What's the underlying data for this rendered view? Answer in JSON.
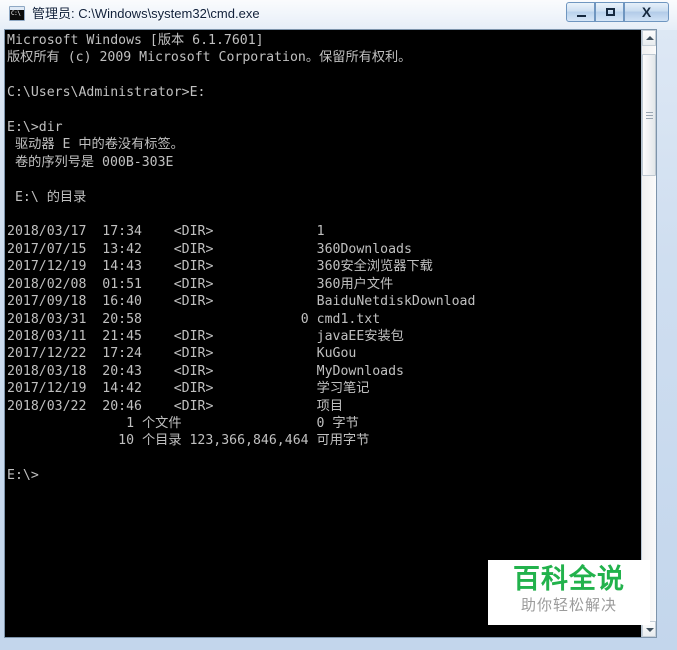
{
  "window": {
    "title": "管理员: C:\\Windows\\system32\\cmd.exe",
    "icon": "cmd-console-icon",
    "icon_prompt": "C:\\",
    "controls": {
      "minimize_label": "最小化",
      "maximize_label": "最大化",
      "close_label": "X"
    }
  },
  "console": {
    "background_color": "#000000",
    "text_color": "#c0c0c0",
    "lines": [
      "Microsoft Windows [版本 6.1.7601]",
      "版权所有 (c) 2009 Microsoft Corporation。保留所有权利。",
      "",
      "C:\\Users\\Administrator>E:",
      "",
      "E:\\>dir",
      " 驱动器 E 中的卷没有标签。",
      " 卷的序列号是 000B-303E",
      "",
      " E:\\ 的目录",
      "",
      "2018/03/17  17:34    <DIR>             1",
      "2017/07/15  13:42    <DIR>             360Downloads",
      "2017/12/19  14:43    <DIR>             360安全浏览器下载",
      "2018/02/08  01:51    <DIR>             360用户文件",
      "2017/09/18  16:40    <DIR>             BaiduNetdiskDownload",
      "2018/03/31  20:58                    0 cmd1.txt",
      "2018/03/11  21:45    <DIR>             javaEE安装包",
      "2017/12/22  17:24    <DIR>             KuGou",
      "2018/03/18  20:43    <DIR>             MyDownloads",
      "2017/12/19  14:42    <DIR>             学习笔记",
      "2018/03/22  20:46    <DIR>             项目",
      "               1 个文件                 0 字节",
      "              10 个目录 123,366,846,464 可用字节",
      "",
      "E:\\>"
    ],
    "header": {
      "os_name": "Microsoft Windows",
      "version": "[版本 6.1.7601]",
      "copyright": "版权所有 (c) 2009 Microsoft Corporation。保留所有权利。"
    },
    "commands": [
      {
        "prompt": "C:\\Users\\Administrator>",
        "command": "E:"
      },
      {
        "prompt": "E:\\>",
        "command": "dir"
      },
      {
        "prompt": "E:\\>",
        "command": ""
      }
    ],
    "volume": {
      "drive": "E",
      "label_line": " 驱动器 E 中的卷没有标签。",
      "serial_line": " 卷的序列号是 000B-303E",
      "serial": "000B-303E",
      "directory_of": " E:\\ 的目录"
    },
    "listing": {
      "rows": [
        {
          "date": "2018/03/17",
          "time": "17:34",
          "type": "<DIR>",
          "size": "",
          "name": "1"
        },
        {
          "date": "2017/07/15",
          "time": "13:42",
          "type": "<DIR>",
          "size": "",
          "name": "360Downloads"
        },
        {
          "date": "2017/12/19",
          "time": "14:43",
          "type": "<DIR>",
          "size": "",
          "name": "360安全浏览器下载"
        },
        {
          "date": "2018/02/08",
          "time": "01:51",
          "type": "<DIR>",
          "size": "",
          "name": "360用户文件"
        },
        {
          "date": "2017/09/18",
          "time": "16:40",
          "type": "<DIR>",
          "size": "",
          "name": "BaiduNetdiskDownload"
        },
        {
          "date": "2018/03/31",
          "time": "20:58",
          "type": "",
          "size": "0",
          "name": "cmd1.txt"
        },
        {
          "date": "2018/03/11",
          "time": "21:45",
          "type": "<DIR>",
          "size": "",
          "name": "javaEE安装包"
        },
        {
          "date": "2017/12/22",
          "time": "17:24",
          "type": "<DIR>",
          "size": "",
          "name": "KuGou"
        },
        {
          "date": "2018/03/18",
          "time": "20:43",
          "type": "<DIR>",
          "size": "",
          "name": "MyDownloads"
        },
        {
          "date": "2017/12/19",
          "time": "14:42",
          "type": "<DIR>",
          "size": "",
          "name": "学习笔记"
        },
        {
          "date": "2018/03/22",
          "time": "20:46",
          "type": "<DIR>",
          "size": "",
          "name": "项目"
        }
      ],
      "summary": {
        "file_count": "1",
        "file_count_label": "个文件",
        "total_bytes": "0",
        "total_bytes_label": "字节",
        "dir_count": "10",
        "dir_count_label": "个目录",
        "free_bytes": "123,366,846,464",
        "free_bytes_label": "可用字节"
      }
    }
  },
  "scrollbar": {
    "up_arrow": "▲",
    "down_arrow": "▼",
    "position": "top"
  },
  "watermark": {
    "main_text": "百科全说",
    "sub_text": "助你轻松解决",
    "main_color": "#22b24c",
    "sub_color": "#9b9b9b"
  }
}
